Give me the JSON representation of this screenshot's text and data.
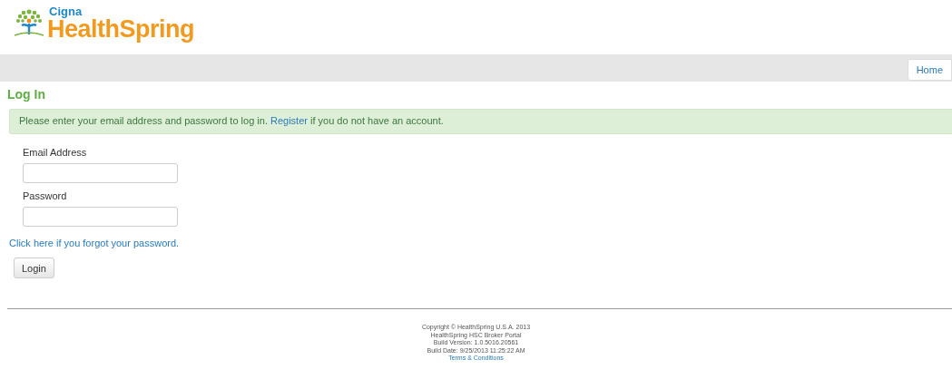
{
  "logo": {
    "brand": "Cigna",
    "product": "HealthSpring"
  },
  "nav": {
    "items": [
      "Home"
    ]
  },
  "heading": "Log In",
  "notice": {
    "before": "Please enter your email address and password to log in.",
    "link": "Register",
    "after": "if you do not have an account."
  },
  "fields": [
    {
      "label": "Email Address"
    },
    {
      "label": "Password"
    }
  ],
  "forgot_link": "Click here if you forgot your password.",
  "button": "Login",
  "footer": {
    "lines": [
      "Copyright © HealthSpring U.S.A. 2013",
      "HealthSpring HSC Broker Portal",
      "Build Version: 1.0.5016.20561",
      "Build Date: 9/25/2013 11:25:22 AM"
    ],
    "link": "Terms & Conditions"
  }
}
